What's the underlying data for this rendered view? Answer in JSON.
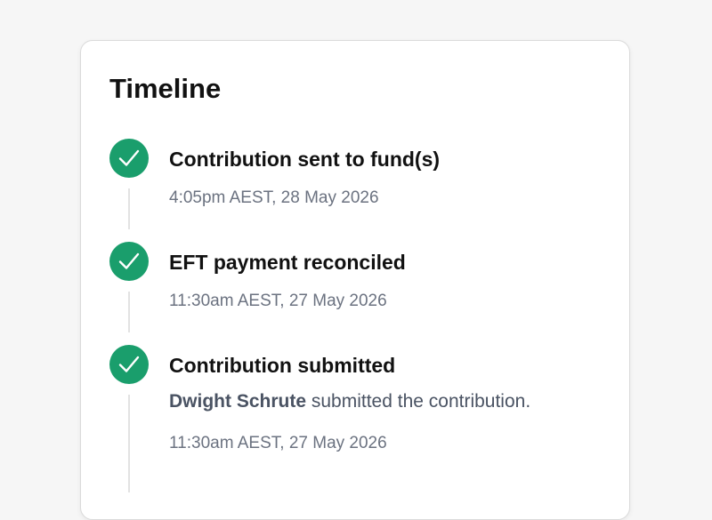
{
  "timeline": {
    "title": "Timeline",
    "status_color": "#1a9e6c",
    "events": [
      {
        "icon": "check-circle-icon",
        "title": "Contribution sent to fund(s)",
        "timestamp": "4:05pm AEST, 28 May 2026"
      },
      {
        "icon": "check-circle-icon",
        "title": "EFT payment reconciled",
        "timestamp": "11:30am AEST, 27 May 2026"
      },
      {
        "icon": "check-circle-icon",
        "title": "Contribution submitted",
        "actor": "Dwight Schrute",
        "description": "submitted the contribution.",
        "timestamp": "11:30am AEST, 27 May 2026"
      }
    ]
  }
}
